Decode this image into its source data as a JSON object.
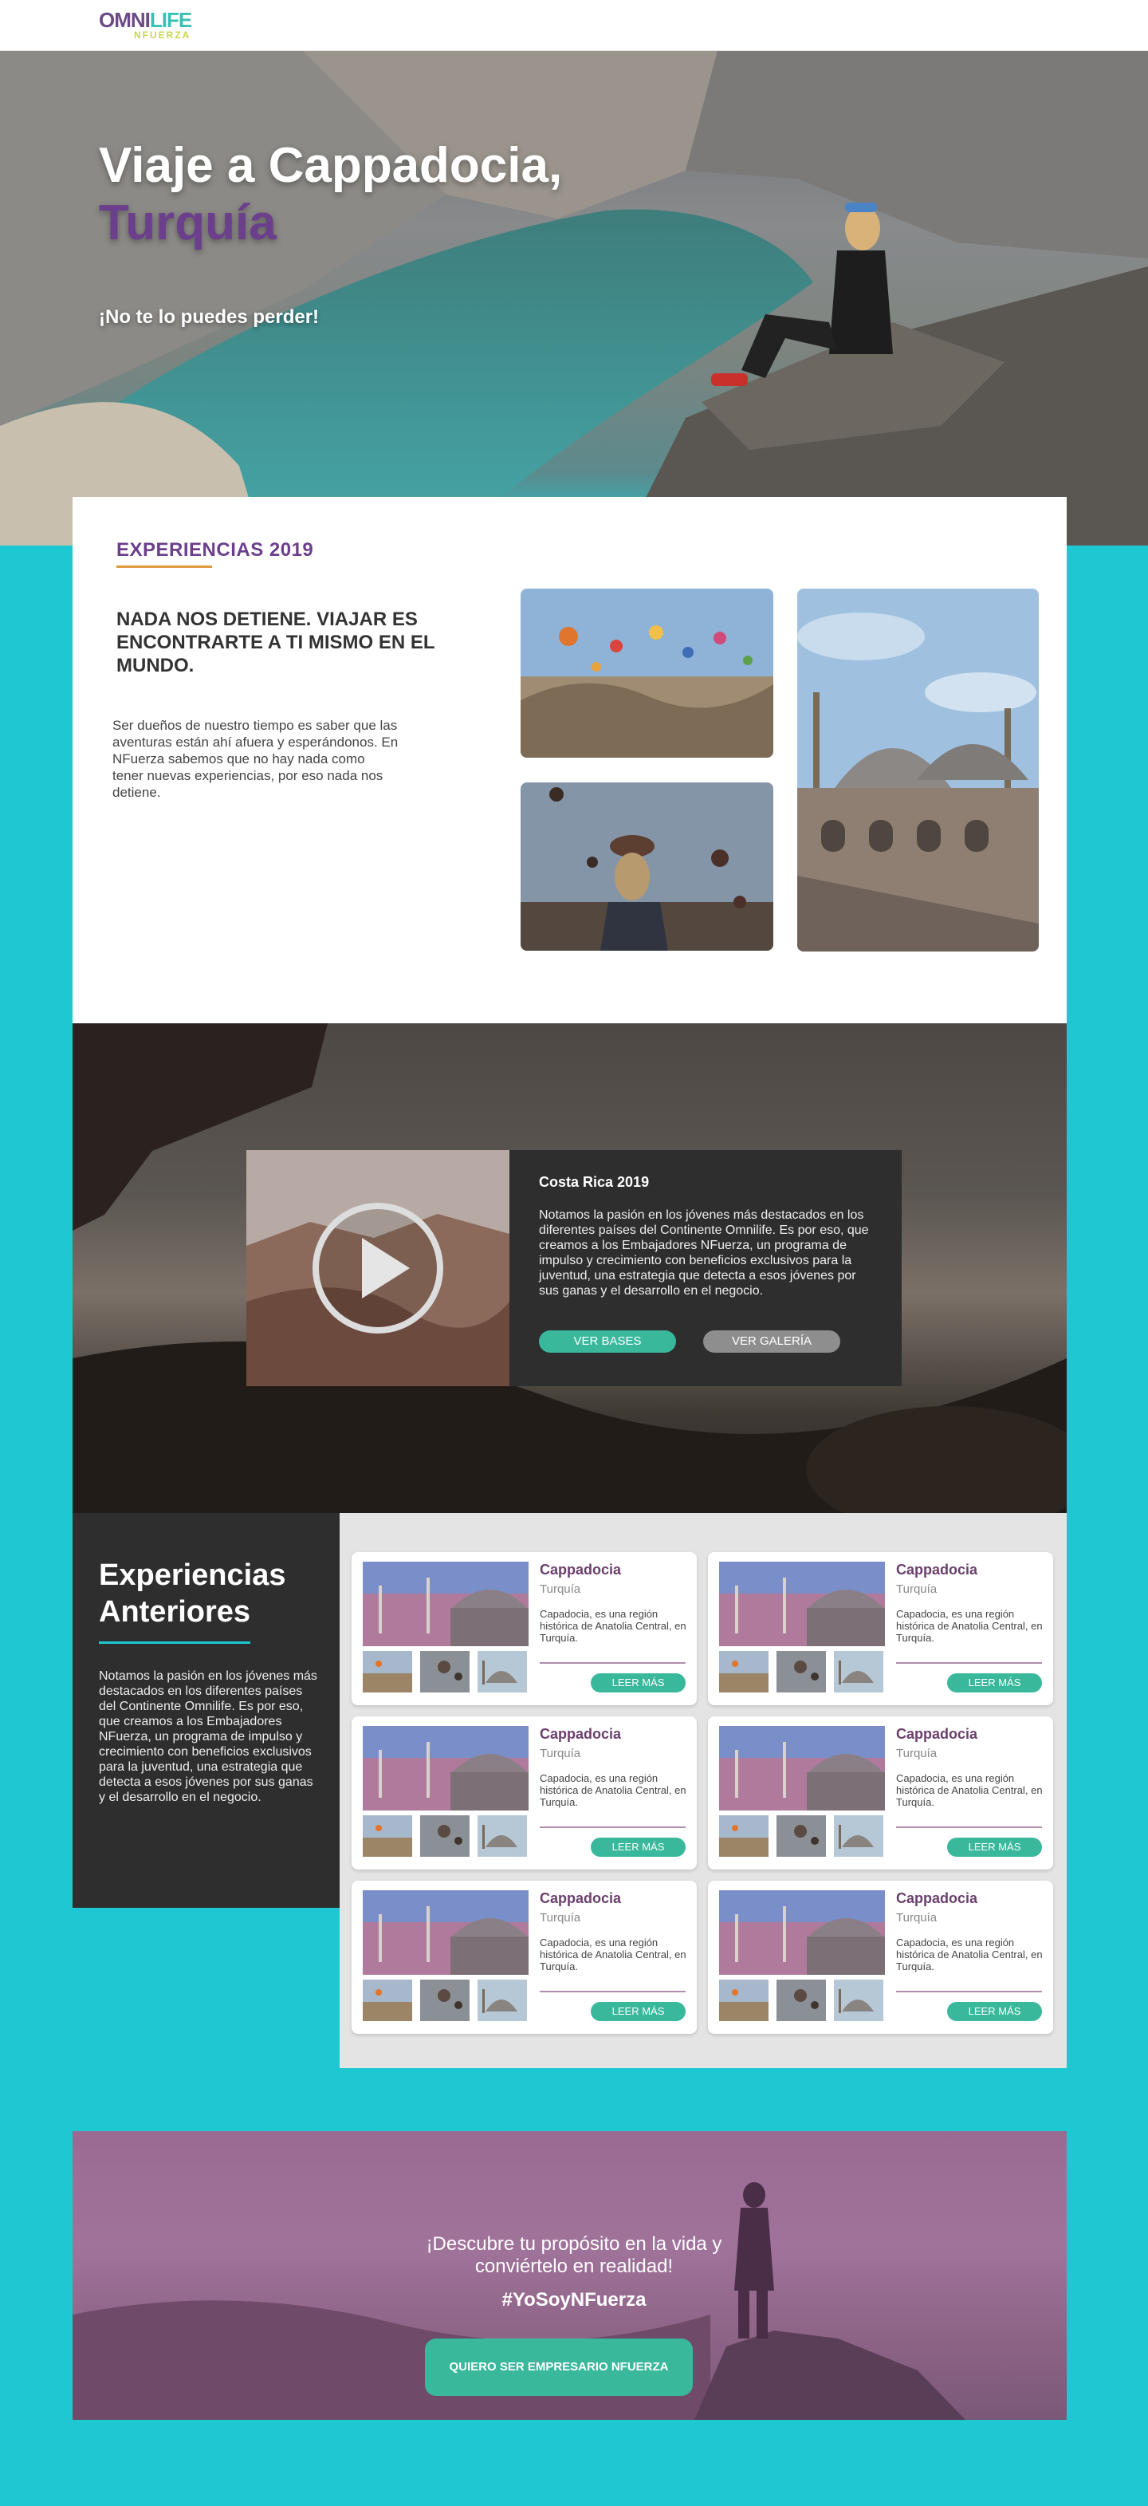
{
  "header": {
    "logo_top_part1": "OMNI",
    "logo_top_part2": "LIFE",
    "logo_bottom": "NFUERZA"
  },
  "hero": {
    "title_line1": "Viaje a Cappadocia,",
    "title_line2": "Turquía",
    "subtitle": "¡No te lo puedes perder!"
  },
  "experiences_2019": {
    "heading": "EXPERIENCIAS 2019",
    "tagline": "NADA NOS DETIENE. VIAJAR ES ENCONTRARTE A TI MISMO EN EL MUNDO.",
    "body": "Ser dueños de nuestro tiempo es saber que las aventuras están ahí afuera y esperándonos. En NFuerza sabemos que no hay nada como tener nuevas experiencias, por eso nada nos detiene."
  },
  "video": {
    "title": "Costa Rica 2019",
    "text": "Notamos la pasión en los jóvenes más destacados en los diferentes países del Continente Omnilife. Es por eso, que creamos a los Embajadores NFuerza, un programa de impulso y crecimiento con beneficios exclusivos para la juventud, una estrategia que detecta a esos jóvenes por sus ganas y el desarrollo en el negocio.",
    "bases_button": "VER BASES",
    "gallery_button": "VER GALERÍA"
  },
  "previous": {
    "title_line1": "Experiencias",
    "title_line2": "Anteriores",
    "body": "Notamos la pasión en los jóvenes más destacados en los diferentes países del Continente Omnilife. Es por eso, que creamos a los Embajadores NFuerza, un programa de impulso y crecimiento con beneficios exclusivos para la juventud, una estrategia que detecta a esos jóvenes por sus ganas y el desarrollo en el negocio.",
    "cards": [
      {
        "title": "Cappadocia",
        "subtitle": "Turquía",
        "description": "Capadocia, es una región histórica de Anatolia Central, en Turquía.",
        "button": "LEER MÁS"
      },
      {
        "title": "Cappadocia",
        "subtitle": "Turquía",
        "description": "Capadocia, es una región histórica de Anatolia Central, en Turquía.",
        "button": "LEER MÁS"
      },
      {
        "title": "Cappadocia",
        "subtitle": "Turquía",
        "description": "Capadocia, es una región histórica de Anatolia Central, en Turquía.",
        "button": "LEER MÁS"
      },
      {
        "title": "Cappadocia",
        "subtitle": "Turquía",
        "description": "Capadocia, es una región histórica de Anatolia Central, en Turquía.",
        "button": "LEER MÁS"
      },
      {
        "title": "Cappadocia",
        "subtitle": "Turquía",
        "description": "Capadocia, es una región histórica de Anatolia Central, en Turquía.",
        "button": "LEER MÁS"
      },
      {
        "title": "Cappadocia",
        "subtitle": "Turquía",
        "description": "Capadocia, es una región histórica de Anatolia Central, en Turquía.",
        "button": "LEER MÁS"
      }
    ]
  },
  "cta": {
    "line1": "¡Descubre tu propósito en la vida y",
    "line2": "conviértelo en realidad!",
    "hashtag": "#YoSoyNFuerza",
    "button": "QUIERO SER EMPRESARIO NFUERZA"
  },
  "colors": {
    "page_background": "#1ec8d2",
    "brand_purple": "#6b3f8c",
    "accent_green": "#39b89c",
    "heading_underline": "#e09a3c",
    "dark_panel": "#2e2e2e"
  }
}
